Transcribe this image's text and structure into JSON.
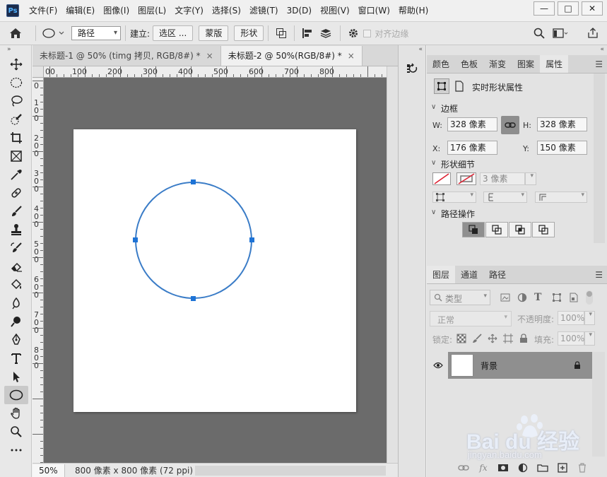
{
  "app": {
    "logo": "Ps"
  },
  "menu": [
    "文件(F)",
    "编辑(E)",
    "图像(I)",
    "图层(L)",
    "文字(Y)",
    "选择(S)",
    "滤镜(T)",
    "3D(D)",
    "视图(V)",
    "窗口(W)",
    "帮助(H)"
  ],
  "window_controls": {
    "minimize": "—",
    "maximize": "□",
    "close": "✕"
  },
  "options": {
    "mode_select": "路径",
    "build_label": "建立:",
    "selection_btn": "选区 ...",
    "mask_btn": "蒙版",
    "shape_btn": "形状",
    "align_edges": "对齐边缘"
  },
  "doc_tabs": [
    {
      "label": "未标题-1 @ 50% (timg 拷贝, RGB/8#) *",
      "close": "×"
    },
    {
      "label": "未标题-2 @ 50%(RGB/8#) *",
      "close": "×"
    }
  ],
  "ruler": {
    "top_labels": [
      "00",
      "100",
      "200",
      "300",
      "400",
      "500",
      "600",
      "700",
      "800"
    ],
    "left_labels": [
      "0",
      "1\n0\n0",
      "2\n0\n0",
      "3\n0\n0",
      "4\n0\n0",
      "5\n0\n0",
      "6\n0\n0",
      "7\n0\n0",
      "8\n0\n0"
    ]
  },
  "status": {
    "zoom": "50%",
    "doc_info": "800 像素 x 800 像素 (72 ppi)",
    "arrow": "❯"
  },
  "colors": {
    "path_stroke": "#3a7cc7",
    "anchor": "#1e73d6",
    "canvas_bg": "#ffffff",
    "work_bg": "#6b6b6b"
  },
  "properties": {
    "tabs": [
      "颜色",
      "色板",
      "渐变",
      "图案",
      "属性"
    ],
    "active_tab": "属性",
    "header": "实时形状属性",
    "bounds_title": "边框",
    "w_label": "W:",
    "w_value": "328 像素",
    "h_label": "H:",
    "h_value": "328 像素",
    "x_label": "X:",
    "x_value": "176 像素",
    "y_label": "Y:",
    "y_value": "150 像素",
    "shape_detail_title": "形状细节",
    "stroke_width": "3 像素",
    "path_ops_title": "路径操作"
  },
  "layers": {
    "tabs": [
      "图层",
      "通道",
      "路径"
    ],
    "kind_label": "类型",
    "blend_mode": "正常",
    "opacity_label": "不透明度:",
    "opacity_value": "100%",
    "lock_label": "锁定:",
    "fill_label": "填充:",
    "fill_value": "100%",
    "items": [
      {
        "name": "背景",
        "visible": true,
        "locked": true
      }
    ]
  },
  "watermark": {
    "brand": "Bai du 经验",
    "url": "jingyan.baidu.com"
  }
}
